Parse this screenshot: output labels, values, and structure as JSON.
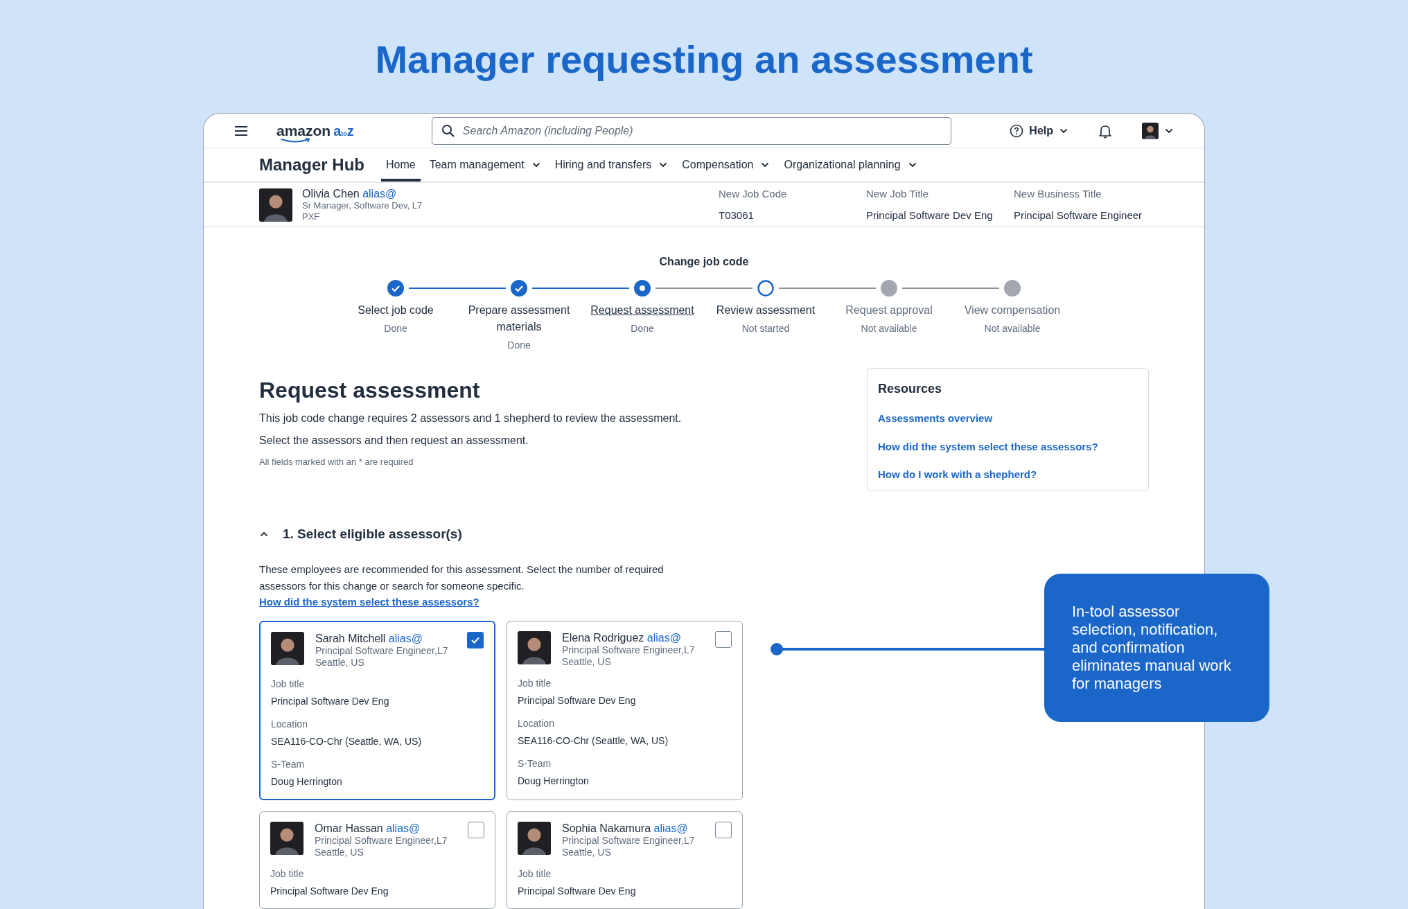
{
  "headline": "Manager requesting an assessment",
  "topbar": {
    "logo_word": "amazon",
    "logo_suffix": "a",
    "logo_to": "to",
    "logo_z": "z",
    "search": {
      "placeholder": "Search Amazon (including People)"
    },
    "help": "Help"
  },
  "nav": {
    "title": "Manager Hub",
    "items": [
      {
        "label": "Home",
        "selected": true,
        "dropdown": false
      },
      {
        "label": "Team management",
        "selected": false,
        "dropdown": true
      },
      {
        "label": "Hiring and transfers",
        "selected": false,
        "dropdown": true
      },
      {
        "label": "Compensation",
        "selected": false,
        "dropdown": true
      },
      {
        "label": "Organizational planning",
        "selected": false,
        "dropdown": true
      }
    ]
  },
  "employee": {
    "name": "Olivia Chen",
    "alias": "alias@",
    "role": "Sr Manager, Software Dev, L7",
    "org": "PXF",
    "fields": [
      {
        "label": "New Job Code",
        "value": "T03061"
      },
      {
        "label": "New Job Title",
        "value": "Principal Software Dev Eng"
      },
      {
        "label": "New Business Title",
        "value": "Principal Software Engineer"
      }
    ]
  },
  "stepper": {
    "title": "Change job code",
    "steps": [
      {
        "label": "Select job code",
        "status": "Done",
        "kind": "done",
        "selected": false
      },
      {
        "label": "Prepare assessment materials",
        "status": "Done",
        "kind": "done",
        "selected": false
      },
      {
        "label": "Request assessment",
        "status": "Done",
        "kind": "current",
        "selected": true
      },
      {
        "label": "Review assessment",
        "status": "Not started",
        "kind": "open",
        "selected": false
      },
      {
        "label": "Request approval",
        "status": "Not available",
        "kind": "unavailable",
        "selected": false
      },
      {
        "label": "View compensation",
        "status": "Not available",
        "kind": "unavailable",
        "selected": false
      }
    ]
  },
  "page": {
    "title": "Request assessment",
    "lines": [
      "This job code change requires 2 assessors and 1 shepherd to review the assessment.",
      "Select the assessors and then request an assessment."
    ],
    "note": "All fields marked with an * are required"
  },
  "resources": {
    "title": "Resources",
    "links": [
      "Assessments overview",
      "How did the system select these assessors?",
      "How do I work with a shepherd?"
    ]
  },
  "section": {
    "title": "1. Select eligible assessor(s)",
    "expanded": true,
    "description": "These employees are recommended for this assessment. Select the number of required assessors for this change or search for someone specific.",
    "link": "How did the system select these assessors?"
  },
  "assessors": [
    {
      "name": "Sarah Mitchell",
      "alias": "alias@",
      "title": "Principal Software Engineer,L7",
      "place": "Seattle, US",
      "checked": true,
      "fields": [
        {
          "label": "Job title",
          "value": "Principal Software Dev Eng"
        },
        {
          "label": "Location",
          "value": "SEA116-CO-Chr (Seattle, WA, US)"
        },
        {
          "label": "S-Team",
          "value": "Doug Herrington"
        }
      ]
    },
    {
      "name": "Elena Rodriguez",
      "alias": "alias@",
      "title": "Principal Software Engineer,L7",
      "place": "Seattle, US",
      "checked": false,
      "fields": [
        {
          "label": "Job title",
          "value": "Principal Software Dev Eng"
        },
        {
          "label": "Location",
          "value": "SEA116-CO-Chr (Seattle, WA, US)"
        },
        {
          "label": "S-Team",
          "value": "Doug Herrington"
        }
      ]
    },
    {
      "name": "Omar Hassan",
      "alias": "alias@",
      "title": "Principal Software Engineer,L7",
      "place": "Seattle, US",
      "checked": false,
      "fields": [
        {
          "label": "Job title",
          "value": "Principal Software Dev Eng"
        }
      ]
    },
    {
      "name": "Sophia Nakamura",
      "alias": "alias@",
      "title": "Principal Software Engineer,L7",
      "place": "Seattle, US",
      "checked": false,
      "fields": [
        {
          "label": "Job title",
          "value": "Principal Software Dev Eng"
        }
      ]
    }
  ],
  "callout": "In-tool assessor selection, notification, and confirmation eliminates manual work for managers"
}
